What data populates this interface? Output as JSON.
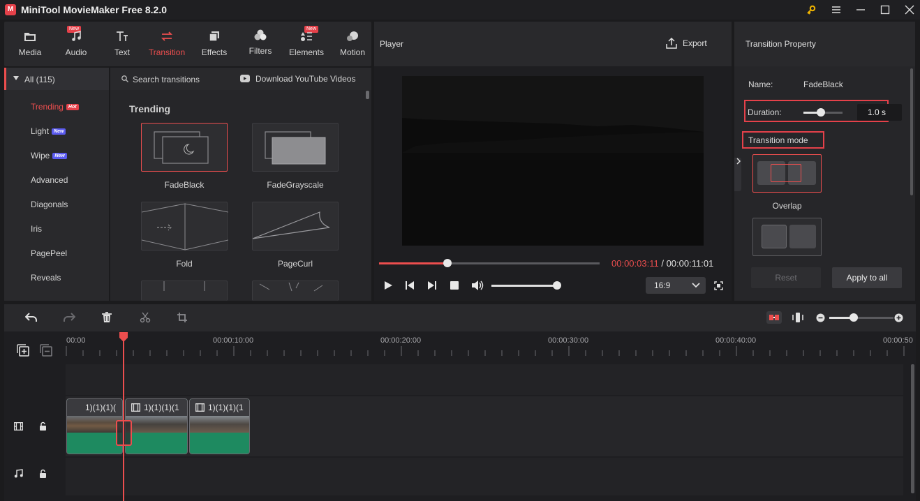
{
  "window": {
    "logo_text": "M",
    "title": "MiniTool MovieMaker Free 8.2.0"
  },
  "toolbar": {
    "items": [
      {
        "label": "Media",
        "icon": "folder-icon"
      },
      {
        "label": "Audio",
        "icon": "music-icon",
        "badge": "New"
      },
      {
        "label": "Text",
        "icon": "text-icon"
      },
      {
        "label": "Transition",
        "icon": "transition-icon",
        "active": true
      },
      {
        "label": "Effects",
        "icon": "effects-icon"
      },
      {
        "label": "Filters",
        "icon": "filters-icon"
      },
      {
        "label": "Elements",
        "icon": "elements-icon",
        "badge": "New"
      },
      {
        "label": "Motion",
        "icon": "motion-icon"
      }
    ]
  },
  "categories": {
    "all": "All (115)",
    "items": [
      {
        "label": "Trending",
        "badge": "Hot",
        "active": true
      },
      {
        "label": "Light",
        "badge": "New"
      },
      {
        "label": "Wipe",
        "badge": "New"
      },
      {
        "label": "Advanced"
      },
      {
        "label": "Diagonals"
      },
      {
        "label": "Iris"
      },
      {
        "label": "PagePeel"
      },
      {
        "label": "Reveals"
      }
    ]
  },
  "transitions": {
    "search_placeholder": "Search transitions",
    "download_label": "Download YouTube Videos",
    "section_title": "Trending",
    "items": [
      {
        "label": "FadeBlack",
        "selected": true
      },
      {
        "label": "FadeGrayscale"
      },
      {
        "label": "Fold"
      },
      {
        "label": "PageCurl"
      }
    ]
  },
  "player": {
    "title": "Player",
    "export_label": "Export",
    "current_time": "00:00:03:11",
    "separator": " / ",
    "total_time": "00:00:11:01",
    "progress": 0.31,
    "volume": 1.0,
    "aspect_ratio": "16:9"
  },
  "property": {
    "title": "Transition Property",
    "name_label": "Name:",
    "name_value": "FadeBlack",
    "duration_label": "Duration:",
    "duration_value": "1.0 s",
    "duration_level": 0.45,
    "mode_label": "Transition mode",
    "modes": [
      {
        "label": "Overlap",
        "selected": true
      }
    ],
    "reset_label": "Reset",
    "apply_label": "Apply to all"
  },
  "timeline": {
    "ruler": [
      "00:00",
      "00:00:10:00",
      "00:00:20:00",
      "00:00:30:00",
      "00:00:40:00",
      "00:00:50"
    ],
    "clips": [
      {
        "label": "1)(1)(1)("
      },
      {
        "label": "1)(1)(1)(1"
      },
      {
        "label": "1)(1)(1)(1"
      }
    ],
    "zoom_level": 0.38
  },
  "colors": {
    "accent": "#ec4e4e",
    "clip_green": "#1e8a60",
    "badge_hot": "#e5414a",
    "badge_new": "#5b5bf0"
  }
}
